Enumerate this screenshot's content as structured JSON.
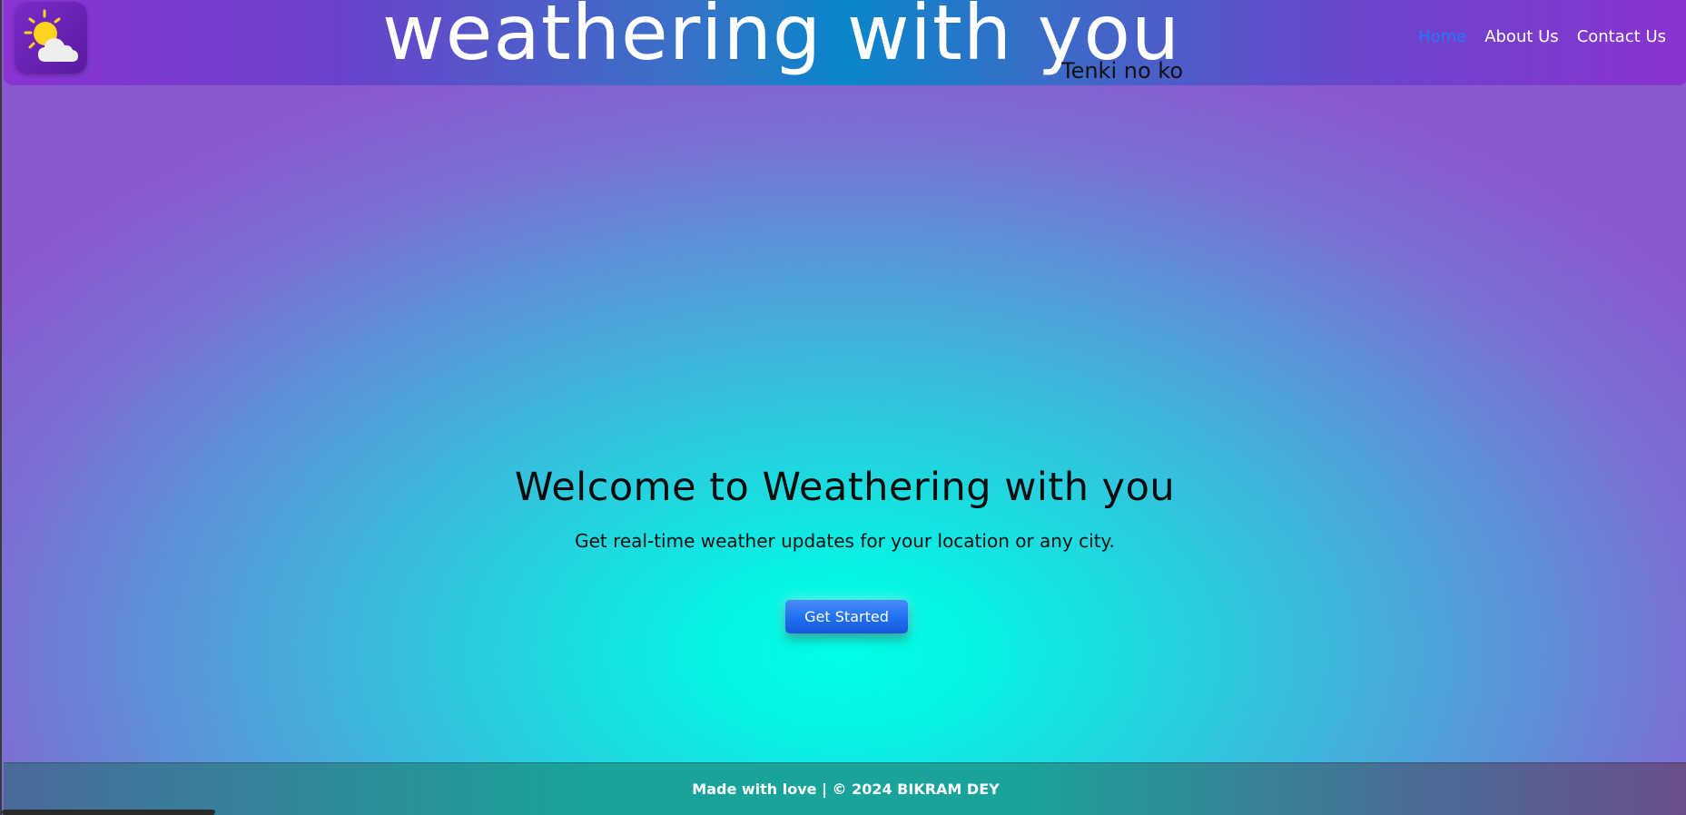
{
  "header": {
    "title": "weathering with you",
    "subtitle": "Tenki no ko",
    "logo_icon": "sun-cloud-icon",
    "nav": [
      {
        "label": "Home",
        "active": true
      },
      {
        "label": "About Us",
        "active": false
      },
      {
        "label": "Contact Us",
        "active": false
      }
    ]
  },
  "hero": {
    "heading": "Welcome to Weathering with you",
    "tagline": "Get real-time weather updates for your location or any city.",
    "cta_label": "Get Started"
  },
  "footer": {
    "text": "Made with love | © 2024 BIKRAM DEY"
  },
  "colors": {
    "accent": "#1f78ff",
    "hero_center": "#00ffe6",
    "hero_edge": "#8a58cf"
  }
}
